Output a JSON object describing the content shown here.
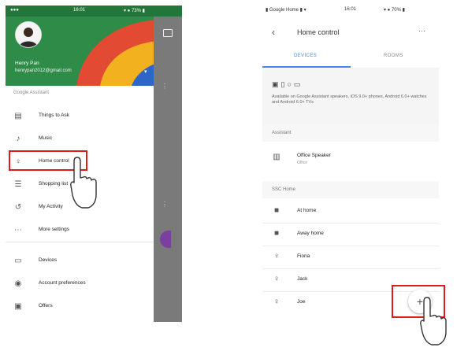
{
  "left": {
    "status_bar": {
      "left": "●●●",
      "time": "16:01",
      "right": "▾ ● 73% ▮"
    },
    "account": {
      "name": "Henry Pan",
      "email": "henrypan2012@gmail.com",
      "arrow": "▾"
    },
    "section_title": "Google Assistant",
    "menu_items": [
      {
        "label": "Things to Ask",
        "icon": "chat-icon",
        "glyph": "▤"
      },
      {
        "label": "Music",
        "icon": "music-note-icon",
        "glyph": "♪"
      },
      {
        "label": "Home control",
        "icon": "lightbulb-icon",
        "glyph": "♀"
      },
      {
        "label": "Shopping list",
        "icon": "list-icon",
        "glyph": "☰"
      },
      {
        "label": "My Activity",
        "icon": "history-icon",
        "glyph": "↺"
      },
      {
        "label": "More settings",
        "icon": "more-horiz-icon",
        "glyph": "⋯"
      }
    ],
    "menu_items_2": [
      {
        "label": "Devices",
        "icon": "devices-icon",
        "glyph": "▭"
      },
      {
        "label": "Account preferences",
        "icon": "account-icon",
        "glyph": "◉"
      },
      {
        "label": "Offers",
        "icon": "offers-icon",
        "glyph": "▣"
      }
    ]
  },
  "right": {
    "status_bar": {
      "left": "▮ Google Home ▮ ▾",
      "time": "16:01",
      "right": "▾ ● 70% ▮"
    },
    "title": "Home control",
    "back": "‹",
    "more": "⋯",
    "tabs": [
      {
        "label": "DEVICES"
      },
      {
        "label": "ROOMS"
      }
    ],
    "info_icons": "▣▯○▭",
    "info_text": "Available on Google Assistant speakers, iOS 9.0+ phones, Android 6.0+ watches and Android 6.0+ TVs",
    "section_assistant": "Assistant",
    "assistant_device": {
      "label": "Office Speaker",
      "sub": "Office",
      "glyph": "▥"
    },
    "section_home": "SSC Home",
    "home_items": [
      {
        "label": "At home",
        "glyph": "■"
      },
      {
        "label": "Away home",
        "glyph": "■"
      },
      {
        "label": "Fiona",
        "glyph": "♀"
      },
      {
        "label": "Jack",
        "glyph": "♀"
      },
      {
        "label": "Joe",
        "glyph": "♀"
      }
    ],
    "fab": "+"
  },
  "colors": {
    "accent": "#4285f4",
    "highlight": "#e01b1b"
  }
}
